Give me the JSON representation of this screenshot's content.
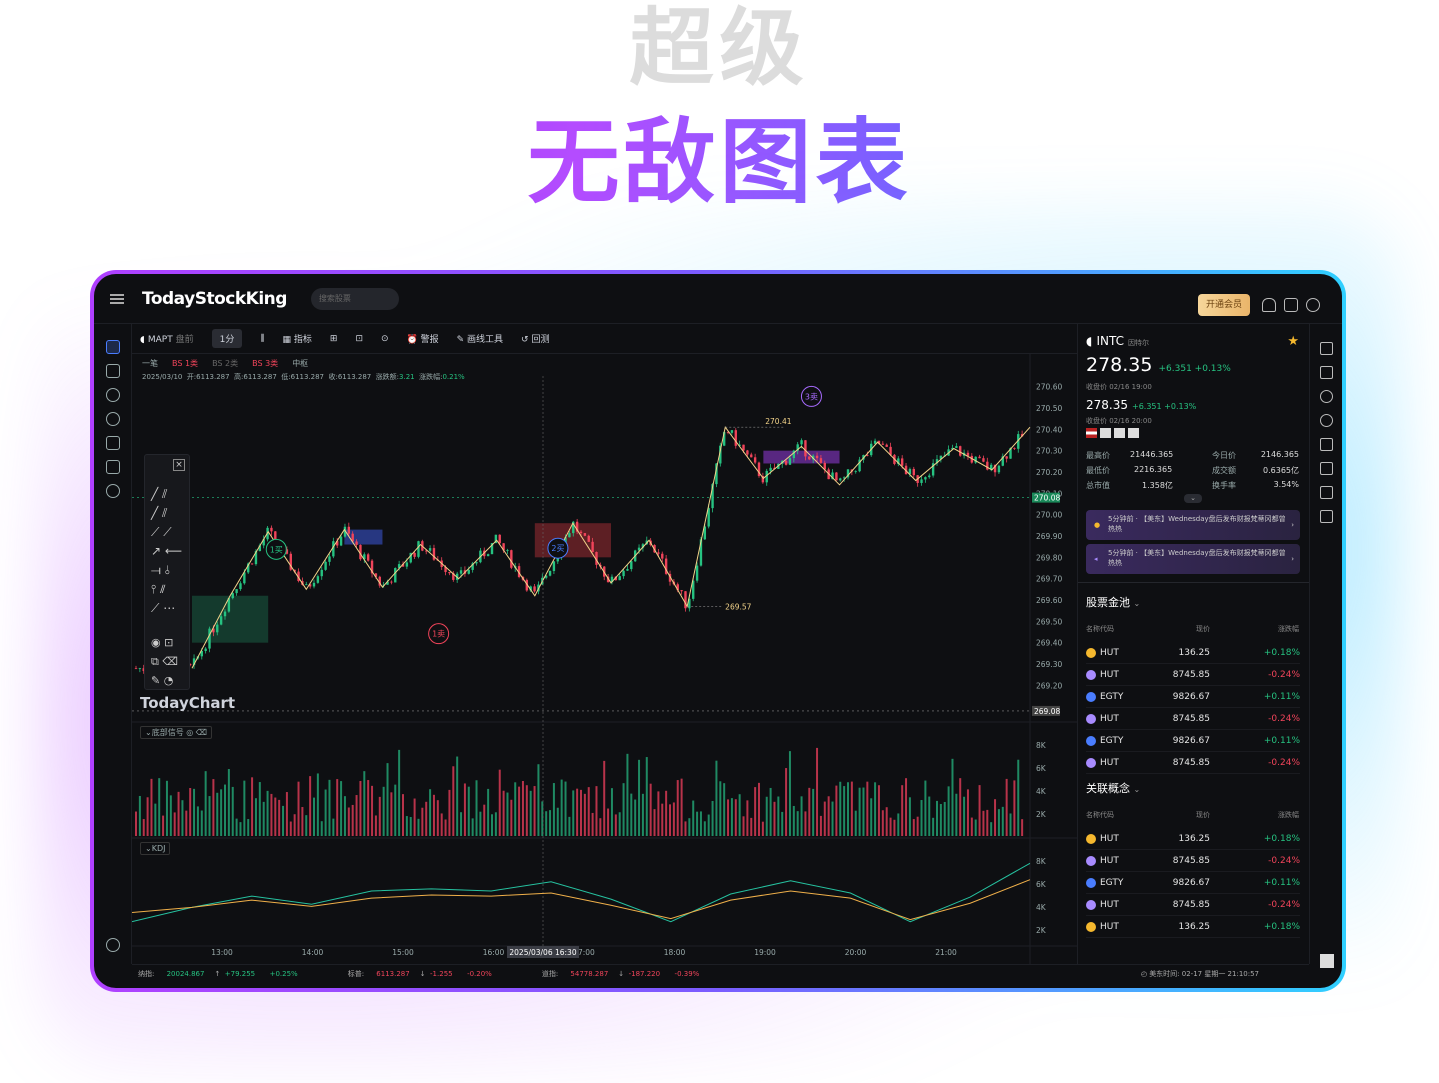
{
  "hero": {
    "line1": "超级",
    "line2": "无敌图表"
  },
  "topbar": {
    "logo": "TodayStockKing",
    "search_placeholder": "搜索股票",
    "vip_button": "开通会员"
  },
  "toolbar": {
    "symbol": "MAPT",
    "session": "盘前",
    "interval": "1分",
    "indicators": "指标",
    "alerts": "警报",
    "draw_tools": "画线工具",
    "replay": "回测"
  },
  "subbar": {
    "items": [
      "一笔",
      "BS 1类",
      "BS 2类",
      "BS 3类",
      "中枢"
    ]
  },
  "ohlc": {
    "date": "2025/03/10",
    "open_label": "开:",
    "open": "6113.287",
    "high_label": "高:",
    "high": "6113.287",
    "low_label": "低:",
    "low": "6113.287",
    "close_label": "收:",
    "close": "6113.287",
    "chg_label": "涨跌额:",
    "chg": "3.21",
    "pct_label": "涨跌幅:",
    "pct": "0.21%"
  },
  "watermark": "TodayChart",
  "panes": {
    "signal": "底部信号",
    "kdj": "KDJ"
  },
  "chart_data": {
    "type": "line",
    "price_axis": [
      "270.60",
      "270.50",
      "270.40",
      "270.30",
      "270.20",
      "270.10",
      "270.00",
      "269.90",
      "269.80",
      "269.70",
      "269.60",
      "269.50",
      "269.40",
      "269.30",
      "269.20"
    ],
    "price_tags": [
      "270.08",
      "269.08"
    ],
    "time_axis": [
      "13:00",
      "14:00",
      "15:00",
      "16:00",
      "17:00",
      "18:00",
      "19:00",
      "20:00",
      "21:00"
    ],
    "crosshair_time": "2025/03/06 16:30",
    "zigzag": [
      269.28,
      269.62,
      269.92,
      269.65,
      269.93,
      269.66,
      269.86,
      269.7,
      269.88,
      269.62,
      269.96,
      269.68,
      269.88,
      269.57,
      270.41,
      270.17,
      270.32,
      270.14,
      270.34,
      270.16,
      270.31,
      270.21,
      270.41
    ],
    "peak_label": "270.41",
    "trough_label": "269.57",
    "signals": [
      {
        "text": "1买",
        "kind": "buy"
      },
      {
        "text": "1卖",
        "kind": "sell"
      },
      {
        "text": "2买",
        "kind": "buy2"
      },
      {
        "text": "3卖",
        "kind": "sell3"
      }
    ],
    "volume_axis": [
      "8K",
      "6K",
      "4K",
      "2K"
    ],
    "kdj_axis": [
      "8K",
      "6K",
      "4K",
      "2K"
    ],
    "kdj_k": [
      1.2,
      2.6,
      3.7,
      2.9,
      4.2,
      4.4,
      4.2,
      5.1,
      3.4,
      1.2,
      3.9,
      5.2,
      4.0,
      1.2,
      3.6,
      6.9
    ],
    "kdj_d": [
      2.1,
      2.6,
      3.3,
      2.7,
      3.5,
      3.8,
      3.7,
      4.0,
      2.8,
      1.5,
      3.3,
      4.2,
      3.5,
      1.4,
      3.0,
      5.3
    ]
  },
  "quote": {
    "symbol": "INTC",
    "name": "因特尔",
    "price": "278.35",
    "change": "+6.351",
    "pct": "+0.13%",
    "close_time": "收盘价 02/16 19:00",
    "post_price": "278.35",
    "post_change": "+6.351",
    "post_pct": "+0.13%",
    "post_time": "收盘价 02/16 20:00",
    "stats": [
      {
        "label": "最高价",
        "value": "21446.365"
      },
      {
        "label": "今日价",
        "value": "2146.365"
      },
      {
        "label": "最低价",
        "value": "2216.365"
      },
      {
        "label": "成交额",
        "value": "0.6365亿"
      },
      {
        "label": "总市值",
        "value": "1.358亿"
      },
      {
        "label": "换手率",
        "value": "3.54%"
      }
    ]
  },
  "news": [
    "5分钟前 · 【美东】Wednesday盘后发布财报梵蒂冈都曾热热",
    "5分钟前 · 【美东】Wednesday盘后发布财报梵蒂冈都曾热热"
  ],
  "pool": {
    "title": "股票金池",
    "headers": [
      "名称代码",
      "现价",
      "涨跌幅"
    ],
    "rows": [
      {
        "name": "HUT",
        "price": "136.25",
        "pct": "+0.18%"
      },
      {
        "name": "HUT",
        "price": "8745.85",
        "pct": "-0.24%"
      },
      {
        "name": "EGTY",
        "price": "9826.67",
        "pct": "+0.11%"
      },
      {
        "name": "HUT",
        "price": "8745.85",
        "pct": "-0.24%"
      },
      {
        "name": "EGTY",
        "price": "9826.67",
        "pct": "+0.11%"
      },
      {
        "name": "HUT",
        "price": "8745.85",
        "pct": "-0.24%"
      }
    ]
  },
  "concept": {
    "title": "关联概念",
    "headers": [
      "名称代码",
      "现价",
      "涨跌幅"
    ],
    "rows": [
      {
        "name": "HUT",
        "price": "136.25",
        "pct": "+0.18%"
      },
      {
        "name": "HUT",
        "price": "8745.85",
        "pct": "-0.24%"
      },
      {
        "name": "EGTY",
        "price": "9826.67",
        "pct": "+0.11%"
      },
      {
        "name": "HUT",
        "price": "8745.85",
        "pct": "-0.24%"
      },
      {
        "name": "HUT",
        "price": "136.25",
        "pct": "+0.18%"
      }
    ]
  },
  "status": {
    "items": [
      {
        "label": "纳指:",
        "value": "20024.867",
        "chg": "+79.255",
        "pct": "+0.25%"
      },
      {
        "label": "标普:",
        "value": "6113.287",
        "chg": "-1.255",
        "pct": "-0.20%"
      },
      {
        "label": "道指:",
        "value": "54778.287",
        "chg": "-187.220",
        "pct": "-0.39%"
      }
    ],
    "clock": "美东时间: 02-17 星期一 21:10:57"
  },
  "colors": {
    "up": "#26c281",
    "down": "#f0445a",
    "accent": "#8a2be2",
    "zigzag": "#f2d38a"
  }
}
